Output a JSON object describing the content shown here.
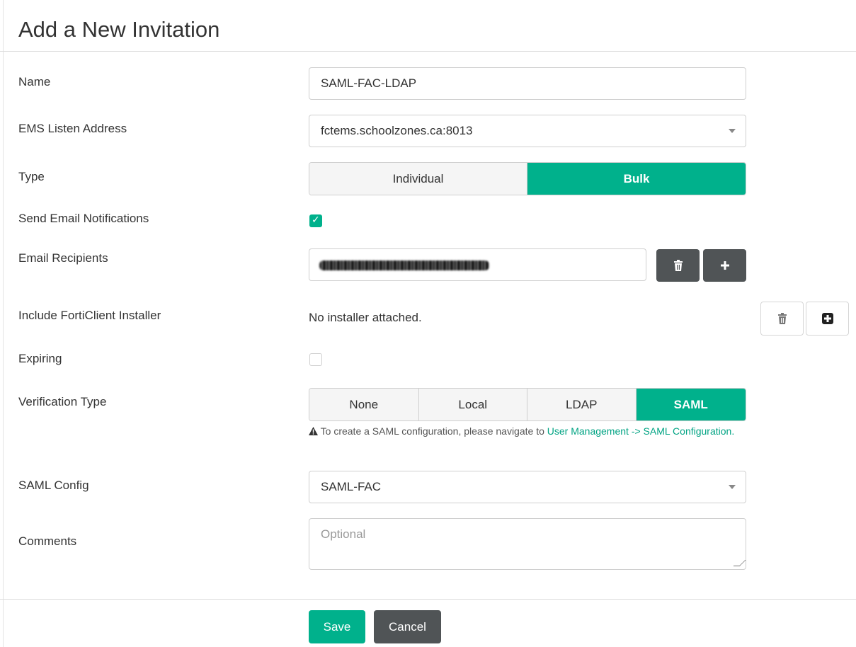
{
  "page": {
    "title": "Add a New Invitation"
  },
  "form": {
    "name": {
      "label": "Name",
      "value": "SAML-FAC-LDAP"
    },
    "ems_listen_address": {
      "label": "EMS Listen Address",
      "value": "fctems.schoolzones.ca:8013"
    },
    "type": {
      "label": "Type",
      "options": [
        "Individual",
        "Bulk"
      ],
      "selected": "Bulk"
    },
    "send_email": {
      "label": "Send Email Notifications",
      "checked": true
    },
    "email_recipients": {
      "label": "Email Recipients",
      "value_redacted": true
    },
    "installer": {
      "label": "Include FortiClient Installer",
      "status": "No installer attached."
    },
    "expiring": {
      "label": "Expiring",
      "checked": false
    },
    "verification": {
      "label": "Verification Type",
      "options": [
        "None",
        "Local",
        "LDAP",
        "SAML"
      ],
      "selected": "SAML",
      "note_prefix": "To create a SAML configuration, please navigate to",
      "note_link": "User Management -> SAML Configuration."
    },
    "saml_config": {
      "label": "SAML Config",
      "value": "SAML-FAC"
    },
    "comments": {
      "label": "Comments",
      "placeholder": "Optional"
    }
  },
  "actions": {
    "save": "Save",
    "cancel": "Cancel"
  },
  "colors": {
    "accent": "#00b18c",
    "dark_button": "#505456"
  }
}
